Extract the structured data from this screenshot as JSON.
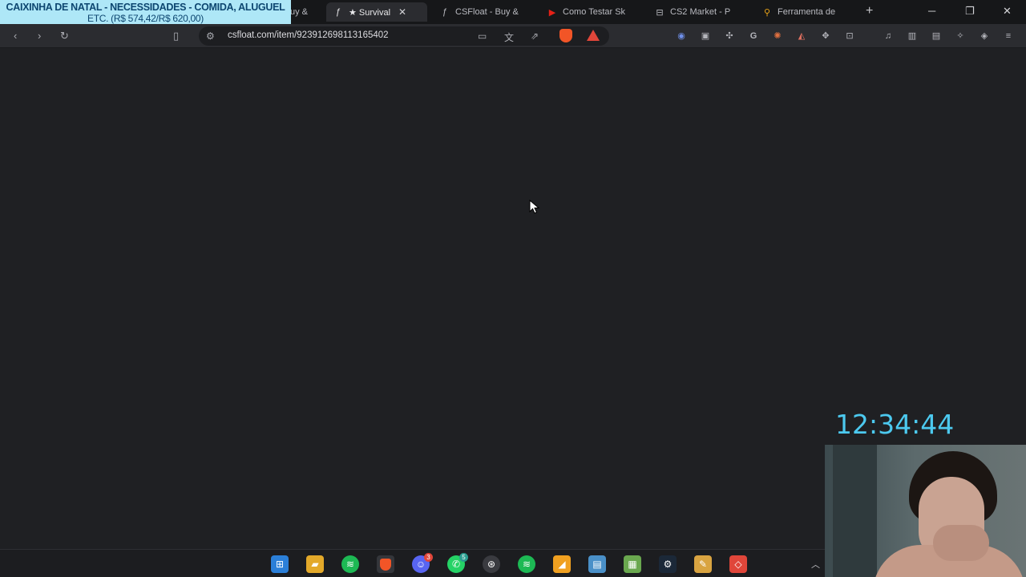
{
  "overlay": {
    "donation_line1": "CAIXINHA DE NATAL - NECESSIDADES - COMIDA, ALUGUEL",
    "donation_line2": "ETC. (R$ 574,42/R$ 620,00)"
  },
  "tabs": [
    {
      "label": "uy &",
      "icon": "document-icon"
    },
    {
      "label": "★ Survival",
      "icon": "csfloat-icon",
      "active": true
    },
    {
      "label": "CSFloat - Buy &",
      "icon": "csfloat-icon"
    },
    {
      "label": "Como Testar Sk",
      "icon": "youtube-icon"
    },
    {
      "label": "CS2 Market - P",
      "icon": "market-icon"
    },
    {
      "label": "Ferramenta de",
      "icon": "search-icon"
    }
  ],
  "toolbar": {
    "url": "csfloat.com/item/923912698113165402"
  },
  "clock": "12:34:44",
  "taskbar": {
    "discord_badge": "3",
    "whatsapp_badge": "5"
  }
}
